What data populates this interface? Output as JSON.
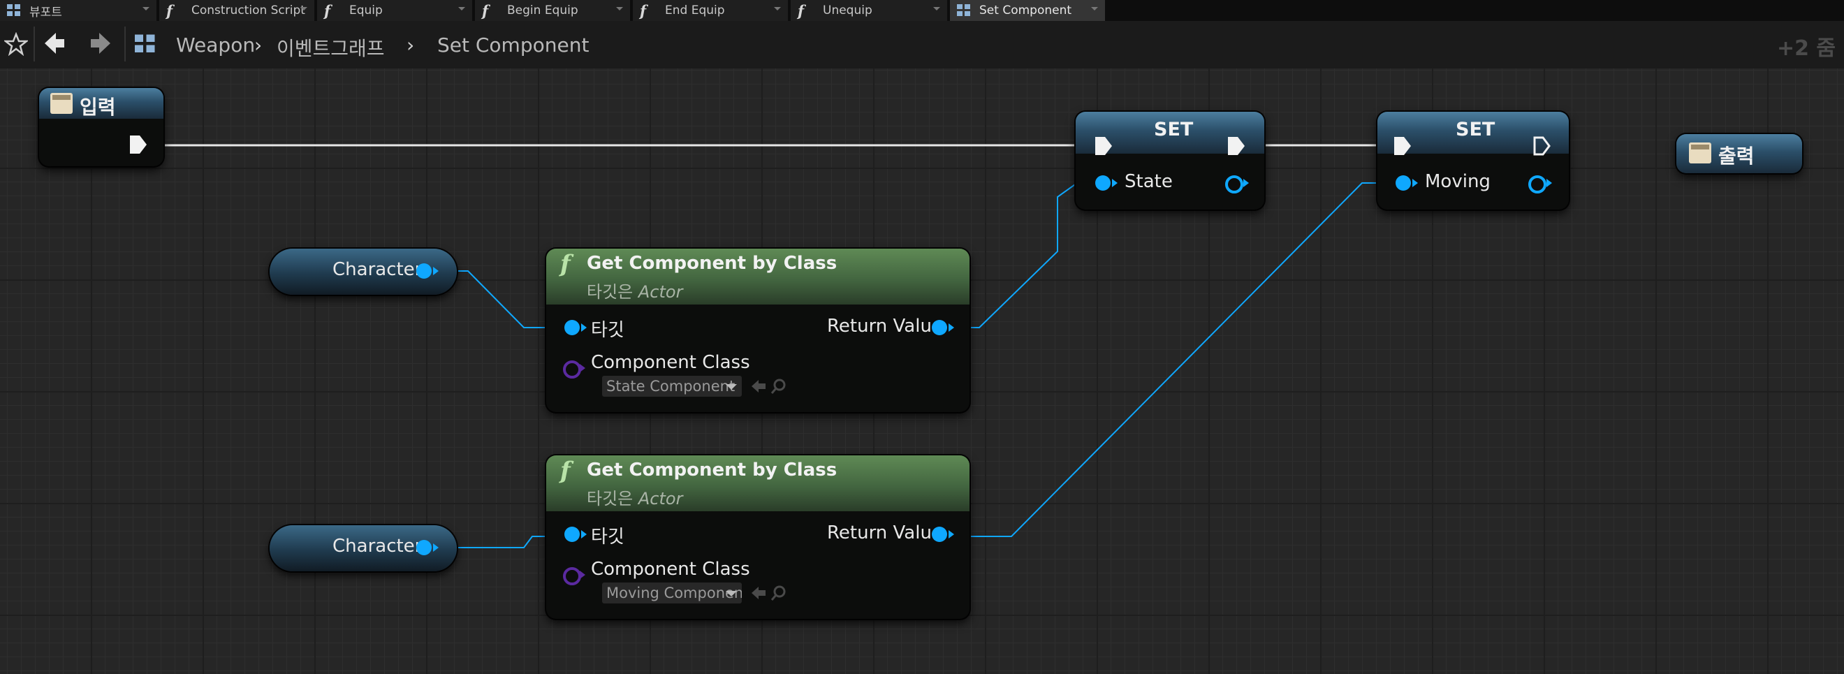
{
  "tabs": [
    {
      "label": "뷰포트",
      "icon": "viewport-grid-icon"
    },
    {
      "label": "Construction Script",
      "icon": "function-icon"
    },
    {
      "label": "Equip",
      "icon": "function-icon"
    },
    {
      "label": "Begin Equip",
      "icon": "function-icon"
    },
    {
      "label": "End Equip",
      "icon": "function-icon"
    },
    {
      "label": "Unequip",
      "icon": "function-icon"
    },
    {
      "label": "Set Component",
      "icon": "graph-grid-icon",
      "active": true
    }
  ],
  "toolbar": {
    "breadcrumb": [
      "Weapon",
      "이벤트그래프",
      "Set Component"
    ],
    "zoom": "+2 줌"
  },
  "graph": {
    "entry_node": {
      "title": "입력"
    },
    "return_node": {
      "title": "출력"
    },
    "set_nodes": [
      {
        "title": "SET",
        "pin_label": "State"
      },
      {
        "title": "SET",
        "pin_label": "Moving"
      }
    ],
    "character_nodes": [
      {
        "label": "Character"
      },
      {
        "label": "Character"
      }
    ],
    "get_component_nodes": [
      {
        "title": "Get Component by Class",
        "subtitle_prefix": "타깃은 ",
        "subtitle_target": "Actor",
        "target_label": "타깃",
        "return_label": "Return Value",
        "class_label": "Component Class",
        "class_value": "State Component"
      },
      {
        "title": "Get Component by Class",
        "subtitle_prefix": "타깃은 ",
        "subtitle_target": "Actor",
        "target_label": "타깃",
        "return_label": "Return Value",
        "class_label": "Component Class",
        "class_value": "Moving Component"
      }
    ]
  },
  "colors": {
    "data_pin": "#0fa8ff",
    "class_pin": "#5b2aa0",
    "exec_wire": "#e8e8e8"
  }
}
